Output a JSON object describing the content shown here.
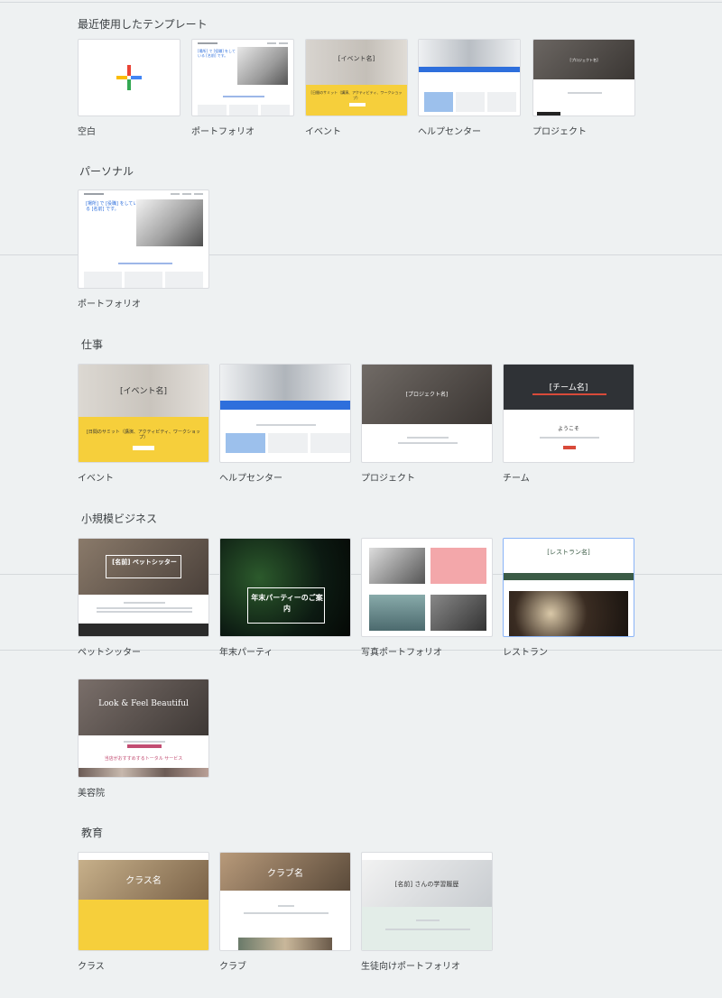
{
  "sections": {
    "recent": {
      "title": "最近使用したテンプレート",
      "cards": [
        "空白",
        "ポートフォリオ",
        "イベント",
        "ヘルプセンター",
        "プロジェクト"
      ]
    },
    "personal": {
      "title": "パーソナル",
      "cards": [
        "ポートフォリオ"
      ]
    },
    "work": {
      "title": "仕事",
      "cards": [
        "イベント",
        "ヘルプセンター",
        "プロジェクト",
        "チーム"
      ]
    },
    "small_business": {
      "title": "小規模ビジネス",
      "cards": [
        "ペットシッター",
        "年末パーティ",
        "写真ポートフォリオ",
        "レストラン",
        "美容院"
      ]
    },
    "education": {
      "title": "教育",
      "cards": [
        "クラス",
        "クラブ",
        "生徒向けポートフォリオ"
      ]
    }
  },
  "thumbnails": {
    "portfolio_headline": "[場所] で [役職] をしている [名前] です。",
    "event_title": "[イベント名]",
    "event_subtitle": "[日間のサミット（講演、アクティビティ、ワークショップ）",
    "team_title": "[チーム名]",
    "team_welcome": "ようこそ",
    "project_title": "[プロジェクト名]",
    "pet_title": "[名前] ペットシッター",
    "party_title": "年末パーティーのご案内",
    "restaurant_title": "[レストラン名]",
    "beauty_title": "Look & Feel Beautiful",
    "beauty_sub": "当店がおすすめするトータル サービス",
    "class_title": "クラス名",
    "club_title": "クラブ名",
    "student_title": "[名前] さんの学習履歴"
  },
  "colors": {
    "yellow": "#f6cf3b",
    "blue": "#2e6fdc",
    "dark": "#2b2b2b",
    "red": "#d94a3a",
    "green": "#3b5b46"
  }
}
